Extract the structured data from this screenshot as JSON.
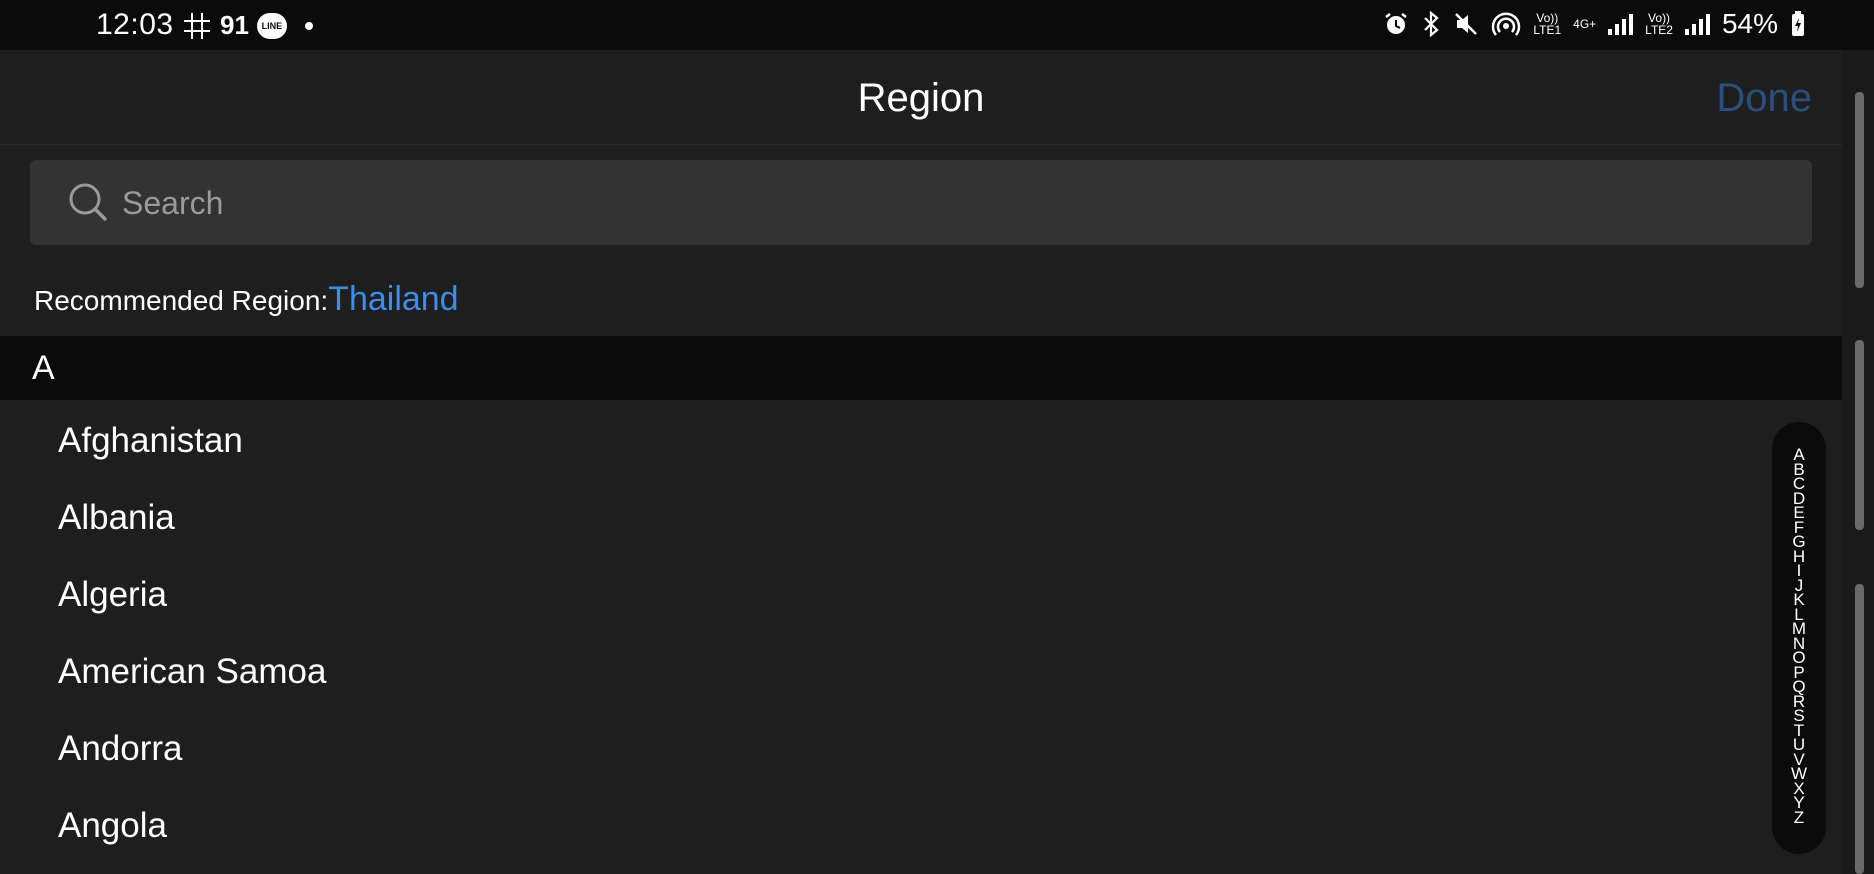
{
  "status_bar": {
    "time": "12:03",
    "notification_count": "91",
    "line_label": "LINE",
    "sim1": "Vo))\nLTE1",
    "network": "4G+",
    "sim2": "Vo))\nLTE2",
    "battery": "54%"
  },
  "header": {
    "title": "Region",
    "done_label": "Done"
  },
  "search": {
    "placeholder": "Search",
    "value": ""
  },
  "recommended": {
    "label": "Recommended Region:",
    "value": "Thailand"
  },
  "section": {
    "letter": "A"
  },
  "regions": [
    "Afghanistan",
    "Albania",
    "Algeria",
    "American Samoa",
    "Andorra",
    "Angola"
  ],
  "index_letters": [
    "A",
    "B",
    "C",
    "D",
    "E",
    "F",
    "G",
    "H",
    "I",
    "J",
    "K",
    "L",
    "M",
    "N",
    "O",
    "P",
    "Q",
    "R",
    "S",
    "T",
    "U",
    "V",
    "W",
    "X",
    "Y",
    "Z"
  ],
  "colors": {
    "background": "#1e1e1e",
    "accent": "#3d8ee8",
    "done_disabled": "#2a4f7d",
    "section_bg": "#0b0b0b"
  }
}
